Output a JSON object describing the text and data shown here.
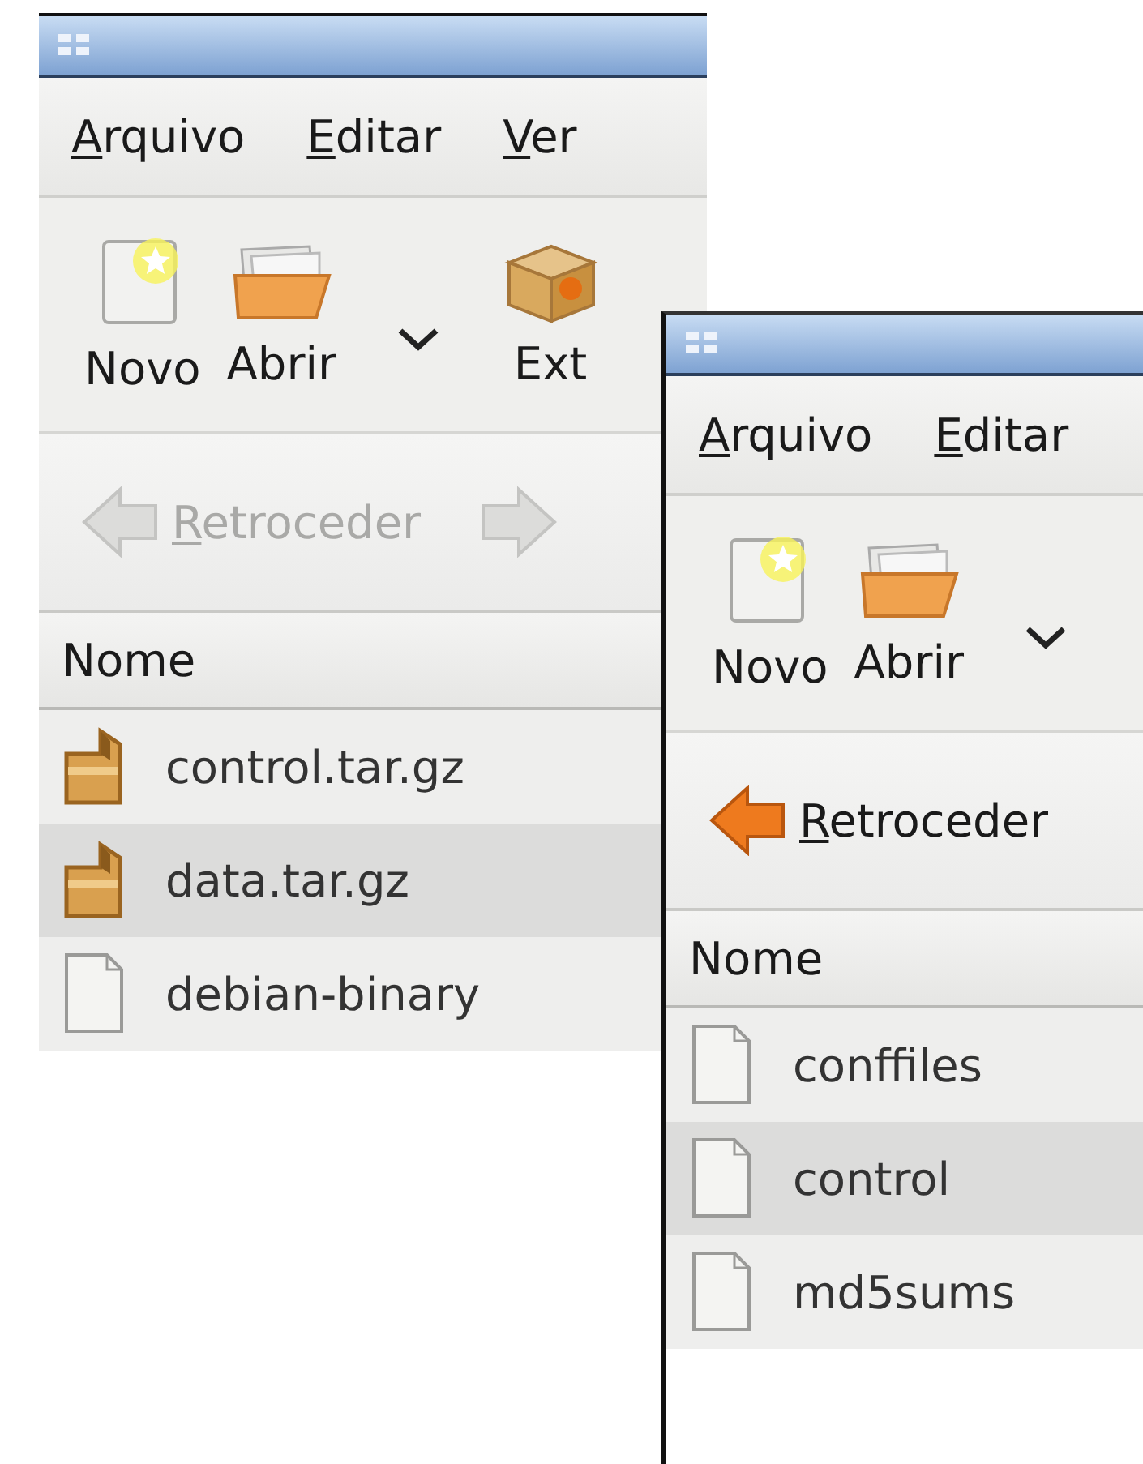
{
  "windows": [
    {
      "menu": [
        {
          "label": "Arquivo"
        },
        {
          "label": "Editar"
        },
        {
          "label": "Ver"
        }
      ],
      "toolbar": [
        {
          "kind": "new",
          "label": "Novo"
        },
        {
          "kind": "open",
          "label": "Abrir"
        },
        {
          "kind": "dropdown"
        },
        {
          "kind": "extract",
          "label": "Ext"
        }
      ],
      "navigation": {
        "back": {
          "label": "Retroceder",
          "disabled": true
        },
        "forward": {
          "disabled": true
        }
      },
      "column": "Nome",
      "files": [
        {
          "name": "control.tar.gz",
          "kind": "archive"
        },
        {
          "name": "data.tar.gz",
          "kind": "archive"
        },
        {
          "name": "debian-binary",
          "kind": "text"
        }
      ]
    },
    {
      "menu": [
        {
          "label": "Arquivo"
        },
        {
          "label": "Editar"
        }
      ],
      "toolbar": [
        {
          "kind": "new",
          "label": "Novo"
        },
        {
          "kind": "open",
          "label": "Abrir"
        },
        {
          "kind": "dropdown"
        }
      ],
      "navigation": {
        "back": {
          "label": "Retroceder",
          "disabled": false
        }
      },
      "column": "Nome",
      "files": [
        {
          "name": "conffiles",
          "kind": "text"
        },
        {
          "name": "control",
          "kind": "text"
        },
        {
          "name": "md5sums",
          "kind": "text"
        }
      ]
    }
  ]
}
